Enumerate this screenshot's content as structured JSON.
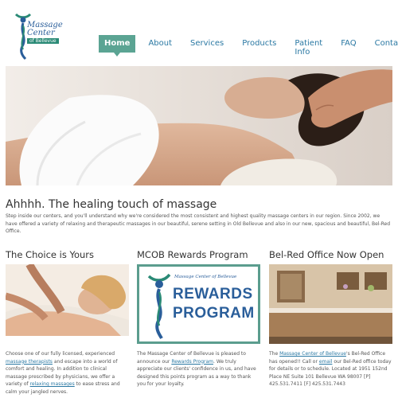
{
  "brand": {
    "line1": "Massage",
    "line2": "Center",
    "sub": "of Bellevue"
  },
  "nav": {
    "items": [
      {
        "label": "Home",
        "active": true
      },
      {
        "label": "About"
      },
      {
        "label": "Services"
      },
      {
        "label": "Products"
      },
      {
        "label": "Patient Info"
      },
      {
        "label": "FAQ"
      },
      {
        "label": "Contact"
      }
    ]
  },
  "intro": {
    "title": "Ahhhh. The healing touch of massage",
    "text": "Step inside our centers, and you'll understand why we're considered the most consistent and highest quality massage centers in our region. Since 2002, we have offered a variety of relaxing and therapeutic massages in our beautiful, serene setting in Old Bellevue and also in our new, spacious and beautiful, Bel-Red Office."
  },
  "columns": [
    {
      "title": "The Choice is Yours",
      "text_parts": [
        {
          "t": "Choose one of our fully licensed, experienced "
        },
        {
          "t": "massage therapists",
          "link": true
        },
        {
          "t": " and escape into a world of comfort and healing. In addition to clinical massage prescribed by physicians, we offer a variety of "
        },
        {
          "t": "relaxing massages",
          "link": true
        },
        {
          "t": " to ease stress and calm your jangled nerves."
        }
      ]
    },
    {
      "title": "MCOB Rewards Program",
      "rewards": {
        "org": "Massage Center of Bellevue",
        "word1": "REWARDS",
        "word2": "PROGRAM"
      },
      "text_parts": [
        {
          "t": "The Massage Center of Bellevue is pleased to announce our "
        },
        {
          "t": "Rewards Program",
          "link": true
        },
        {
          "t": ". We truly appreciate our clients' confidence in us, and have designed this points program as a way to thank you for your loyalty."
        }
      ]
    },
    {
      "title": "Bel-Red Office Now Open",
      "text_parts": [
        {
          "t": "The "
        },
        {
          "t": "Massage Center of Bellevue",
          "link": true
        },
        {
          "t": "'s Bel-Red Office has opened!! Call or "
        },
        {
          "t": "email",
          "link": true
        },
        {
          "t": " our Bel-Red office today for details or to schedule. Located at 1951 152nd Place NE Suite 101 Bellevue WA 98007 [P] 425.531.7411 [F] 425.531.7443"
        }
      ]
    }
  ],
  "colors": {
    "accent": "#5ba493",
    "link": "#2a78a3",
    "brand_blue": "#2a5e9a",
    "brand_green": "#2a8a76"
  }
}
